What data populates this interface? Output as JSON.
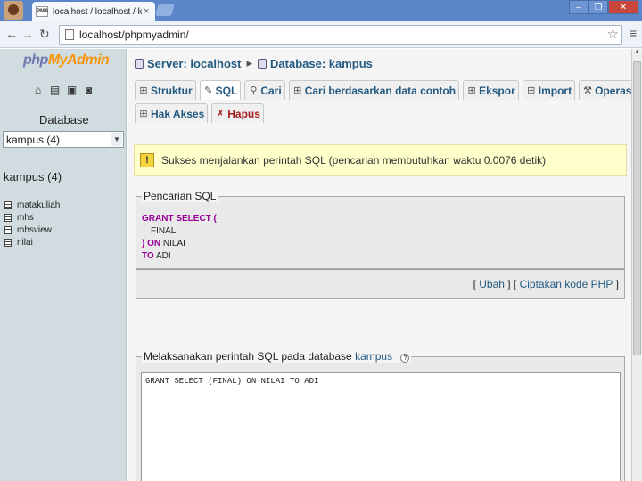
{
  "browser": {
    "tab_title": "localhost / localhost / kampus",
    "tab_favicon_text": "PMA",
    "tab_close": "×",
    "address": "localhost/phpmyadmin/",
    "win_minimize": "–",
    "win_restore": "❐",
    "win_close": "✕",
    "back": "←",
    "forward": "→",
    "reload": "↻",
    "star": "☆",
    "wrench": "🔧"
  },
  "sidebar": {
    "logo_php": "php",
    "logo_myadmin": "MyAdmin",
    "db_label": "Database",
    "db_selected": "kampus (4)",
    "db_heading": "kampus (4)",
    "tables": [
      "matakuliah",
      "mhs",
      "mhsview",
      "nilai"
    ]
  },
  "header": {
    "server": "Server: localhost",
    "database": "Database: kampus",
    "separator": "▸"
  },
  "tabs_row1": [
    {
      "label": "Struktur",
      "icon": "⊞"
    },
    {
      "label": "SQL",
      "icon": "✎"
    },
    {
      "label": "Cari",
      "icon": "⚲"
    },
    {
      "label": "Cari berdasarkan data contoh",
      "icon": "⊞"
    },
    {
      "label": "Ekspor",
      "icon": "⊞"
    },
    {
      "label": "Import",
      "icon": "⊞"
    },
    {
      "label": "Operasi",
      "icon": "⚒"
    }
  ],
  "tabs_row2": [
    {
      "label": "Hak Akses",
      "icon": "⊞"
    },
    {
      "label": "Hapus",
      "icon": "✗"
    }
  ],
  "message": {
    "icon": "!",
    "text": "Sukses menjalankan perintah SQL (pencarian membutuhkan waktu 0.0076 detik)"
  },
  "query_panel": {
    "legend": "Pencarian SQL",
    "line1": "GRANT SELECT (",
    "line2": "FINAL",
    "line3_kw": ") ON",
    "line3_rest": " NILAI",
    "line4_kw": "TO",
    "line4_rest": " ADI",
    "link_edit": "Ubah",
    "link_php": "Ciptakan kode PHP"
  },
  "run_panel": {
    "legend_prefix": "Melaksanakan perintah SQL pada database",
    "legend_db": "kampus",
    "help_icon": "?",
    "sql_value": "GRANT SELECT (FINAL) ON NILAI TO ADI"
  }
}
